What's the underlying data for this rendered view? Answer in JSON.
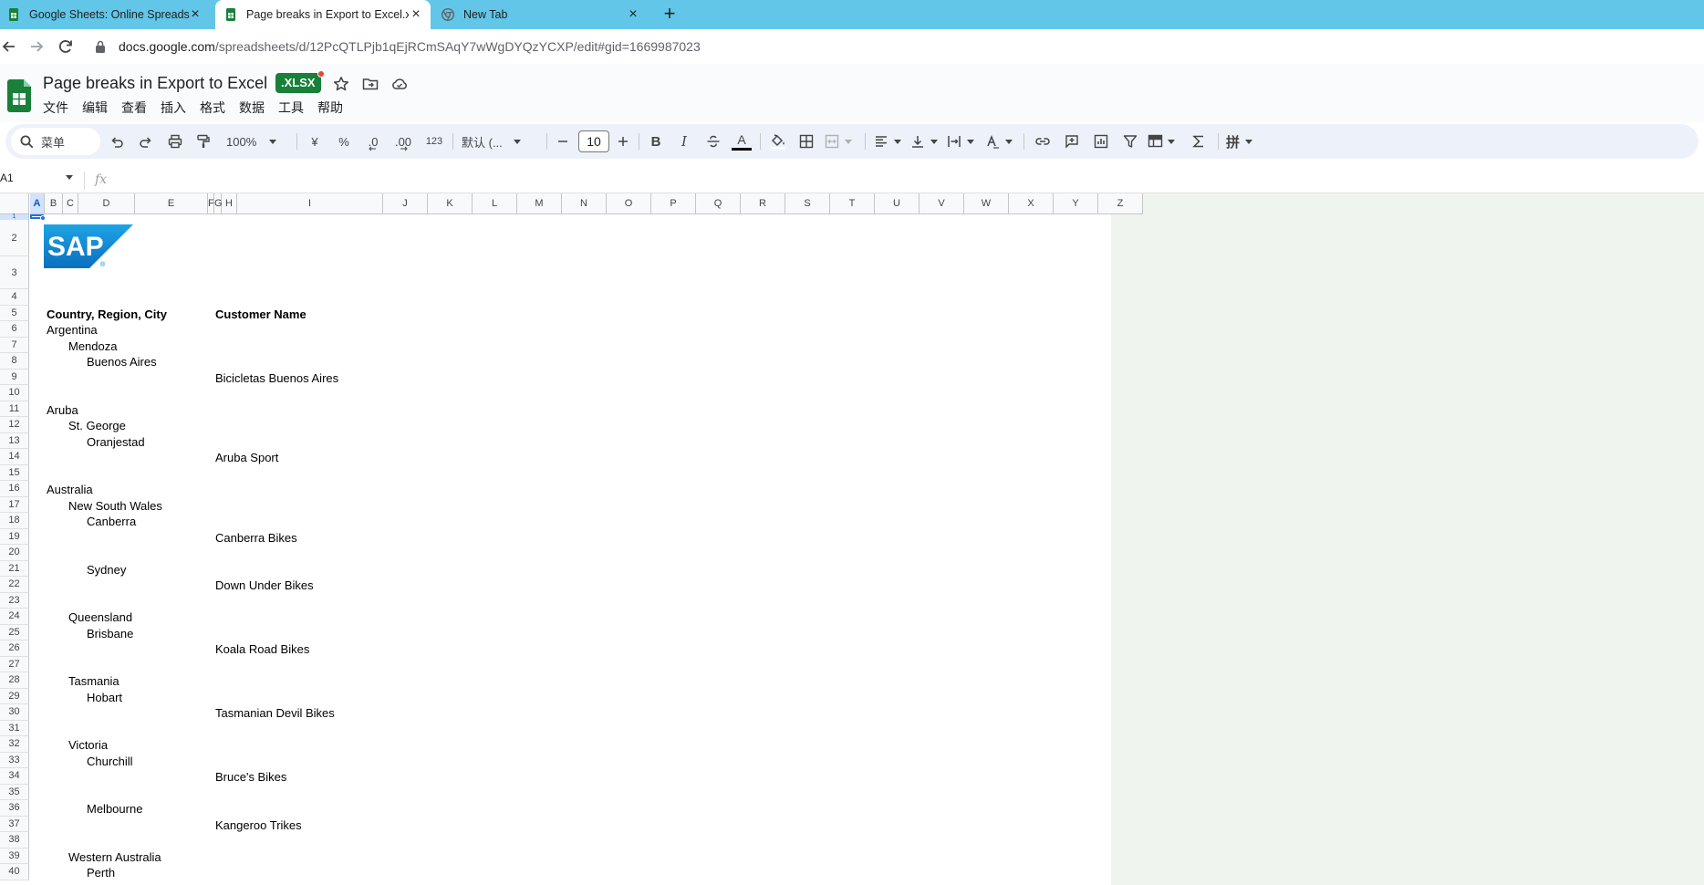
{
  "browser": {
    "tabs": [
      {
        "title": "Google Sheets: Online Spreadshe",
        "active": false
      },
      {
        "title": "Page breaks in Export to Excel.xls",
        "active": true
      },
      {
        "title": "New Tab",
        "active": false
      }
    ],
    "url_host": "docs.google.com",
    "url_path": "/spreadsheets/d/12PcQTLPjb1qEjRCmSAqY7wWgDYQzYCXP/edit#gid=1669987023"
  },
  "app": {
    "doc_title": "Page breaks in Export to Excel",
    "file_badge": ".XLSX",
    "menus": [
      "文件",
      "编辑",
      "查看",
      "插入",
      "格式",
      "数据",
      "工具",
      "帮助"
    ]
  },
  "toolbar": {
    "search_label": "菜单",
    "zoom": "100%",
    "currency": "¥",
    "percent": "%",
    "dec_decrease": ".0",
    "dec_increase": ".00",
    "number_format": "123",
    "font": "默认 (...",
    "font_size": "10",
    "bold": "B",
    "italic": "I",
    "text_color": "A",
    "input_tools": "拼"
  },
  "formula_bar": {
    "name_box": "A1",
    "fx": "fx"
  },
  "grid": {
    "columns": [
      "A",
      "B",
      "C",
      "D",
      "E",
      "F",
      "G",
      "H",
      "I",
      "J",
      "K",
      "L",
      "M",
      "N",
      "O",
      "P",
      "Q",
      "R",
      "S",
      "T",
      "U",
      "V",
      "W",
      "X",
      "Y",
      "Z"
    ],
    "selected_column": "A",
    "rows": [
      "1",
      "2",
      "3",
      "4",
      "5",
      "6",
      "7",
      "8",
      "9",
      "10",
      "11",
      "12",
      "13",
      "14",
      "15",
      "16",
      "17",
      "18",
      "19",
      "20",
      "21",
      "22",
      "23",
      "24",
      "25",
      "26",
      "27",
      "28",
      "29",
      "30",
      "31",
      "32",
      "33",
      "34",
      "35",
      "36",
      "37",
      "38",
      "39",
      "40"
    ],
    "logo_text": "SAP",
    "header_country": "Country, Region, City",
    "header_customer": "Customer Name",
    "cells": [
      {
        "row": 6,
        "level": 0,
        "text": "Argentina"
      },
      {
        "row": 7,
        "level": 1,
        "text": "Mendoza"
      },
      {
        "row": 8,
        "level": 2,
        "text": "Buenos Aires"
      },
      {
        "row": 9,
        "level": 3,
        "text": "Bicicletas Buenos Aires"
      },
      {
        "row": 11,
        "level": 0,
        "text": "Aruba"
      },
      {
        "row": 12,
        "level": 1,
        "text": "St. George"
      },
      {
        "row": 13,
        "level": 2,
        "text": "Oranjestad"
      },
      {
        "row": 14,
        "level": 3,
        "text": "Aruba Sport"
      },
      {
        "row": 16,
        "level": 0,
        "text": "Australia"
      },
      {
        "row": 17,
        "level": 1,
        "text": "New South Wales"
      },
      {
        "row": 18,
        "level": 2,
        "text": "Canberra"
      },
      {
        "row": 19,
        "level": 3,
        "text": "Canberra Bikes"
      },
      {
        "row": 21,
        "level": 2,
        "text": "Sydney"
      },
      {
        "row": 22,
        "level": 3,
        "text": "Down Under Bikes"
      },
      {
        "row": 24,
        "level": 1,
        "text": "Queensland"
      },
      {
        "row": 25,
        "level": 2,
        "text": "Brisbane"
      },
      {
        "row": 26,
        "level": 3,
        "text": "Koala Road Bikes"
      },
      {
        "row": 28,
        "level": 1,
        "text": "Tasmania"
      },
      {
        "row": 29,
        "level": 2,
        "text": "Hobart"
      },
      {
        "row": 30,
        "level": 3,
        "text": "Tasmanian Devil Bikes"
      },
      {
        "row": 32,
        "level": 1,
        "text": "Victoria"
      },
      {
        "row": 33,
        "level": 2,
        "text": "Churchill"
      },
      {
        "row": 34,
        "level": 3,
        "text": "Bruce's Bikes"
      },
      {
        "row": 36,
        "level": 2,
        "text": "Melbourne"
      },
      {
        "row": 37,
        "level": 3,
        "text": "Kangeroo Trikes"
      },
      {
        "row": 39,
        "level": 1,
        "text": "Western Australia"
      },
      {
        "row": 40,
        "level": 2,
        "text": "Perth"
      }
    ]
  }
}
